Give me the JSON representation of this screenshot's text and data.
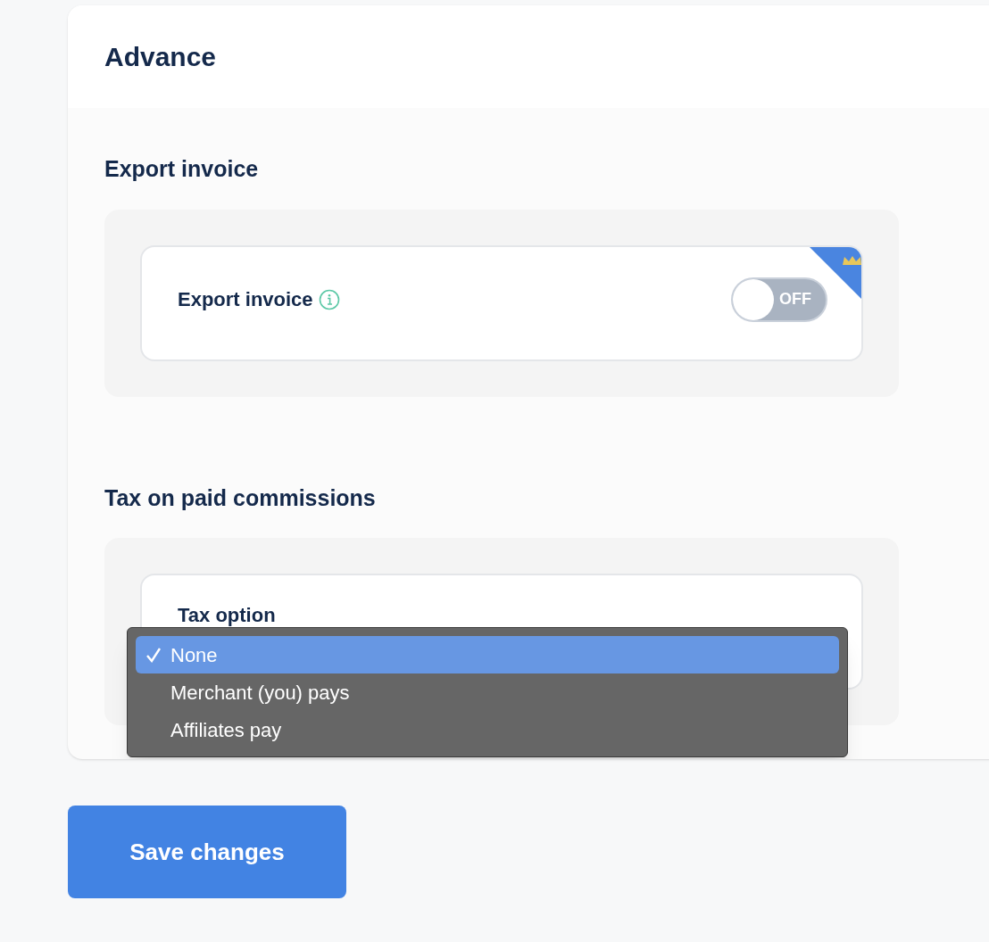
{
  "card": {
    "title": "Advance"
  },
  "sections": [
    {
      "heading": "Export invoice",
      "kind": "toggle",
      "label": "Export invoice",
      "info": true,
      "premium": true,
      "toggle": {
        "on": false,
        "text": "OFF"
      }
    },
    {
      "heading": "Tax on paid commissions",
      "kind": "select",
      "label": "Tax option",
      "options": [
        {
          "label": "None",
          "selected": true
        },
        {
          "label": "Merchant (you) pays",
          "selected": false
        },
        {
          "label": "Affiliates pay",
          "selected": false
        }
      ]
    }
  ],
  "save_button": "Save changes"
}
